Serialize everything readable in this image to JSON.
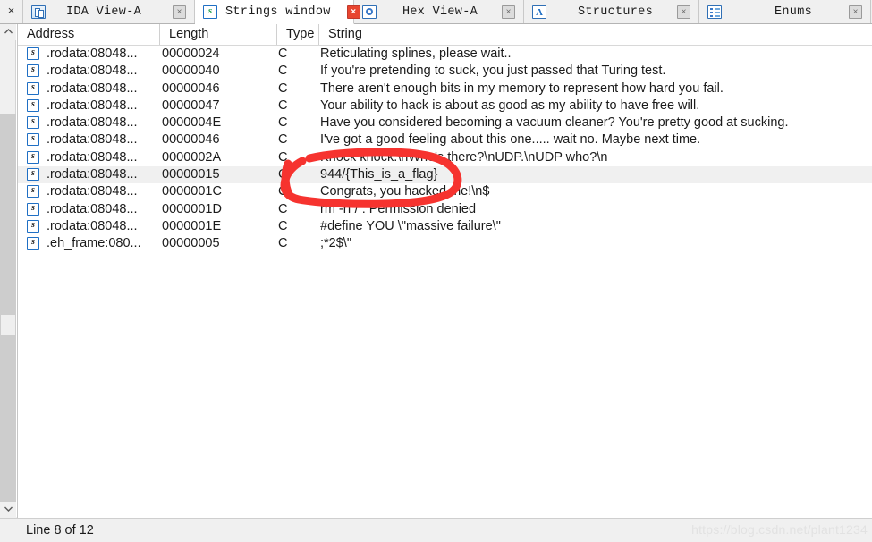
{
  "window": {
    "close_all_glyph": "×"
  },
  "tabs": [
    {
      "label": "IDA View-A",
      "icon": "document-icon",
      "active": false,
      "close_glyph": "×"
    },
    {
      "label": "Strings window",
      "icon": "strings-icon",
      "active": true,
      "close_glyph": "×"
    },
    {
      "label": "Hex View-A",
      "icon": "hex-view-icon",
      "active": false,
      "close_glyph": "×"
    },
    {
      "label": "Structures",
      "icon": "structures-icon",
      "active": false,
      "close_glyph": "×"
    },
    {
      "label": "Enums",
      "icon": "enums-icon",
      "active": false,
      "close_glyph": "×"
    }
  ],
  "table": {
    "columns": [
      "Address",
      "Length",
      "Type",
      "String"
    ],
    "rows": [
      {
        "address": ".rodata:08048...",
        "length": "00000024",
        "type": "C",
        "string": "Reticulating splines, please wait..",
        "selected": false
      },
      {
        "address": ".rodata:08048...",
        "length": "00000040",
        "type": "C",
        "string": "If you're pretending to suck, you just passed that Turing test.",
        "selected": false
      },
      {
        "address": ".rodata:08048...",
        "length": "00000046",
        "type": "C",
        "string": "There aren't enough bits in my memory to represent how hard you fail.",
        "selected": false
      },
      {
        "address": ".rodata:08048...",
        "length": "00000047",
        "type": "C",
        "string": "Your ability to hack is about as good as my ability to have free will.",
        "selected": false
      },
      {
        "address": ".rodata:08048...",
        "length": "0000004E",
        "type": "C",
        "string": "Have you considered becoming a vacuum cleaner? You're pretty good at sucking.",
        "selected": false
      },
      {
        "address": ".rodata:08048...",
        "length": "00000046",
        "type": "C",
        "string": "I've got a good feeling about this one..... wait no. Maybe next time.",
        "selected": false
      },
      {
        "address": ".rodata:08048...",
        "length": "0000002A",
        "type": "C",
        "string": "Knock knock.\\nWho's there?\\nUDP.\\nUDP who?\\n",
        "selected": false
      },
      {
        "address": ".rodata:08048...",
        "length": "00000015",
        "type": "C",
        "string": "944/{This_is_a_flag}",
        "selected": true
      },
      {
        "address": ".rodata:08048...",
        "length": "0000001C",
        "type": "C",
        "string": "Congrats, you hacked me!\\n$",
        "selected": false
      },
      {
        "address": ".rodata:08048...",
        "length": "0000001D",
        "type": "C",
        "string": "rm -rf / : Permission denied",
        "selected": false
      },
      {
        "address": ".rodata:08048...",
        "length": "0000001E",
        "type": "C",
        "string": "#define YOU \\\"massive failure\\\"",
        "selected": false
      },
      {
        "address": ".eh_frame:080...",
        "length": "00000005",
        "type": "C",
        "string": ";*2$\\\"",
        "selected": false
      }
    ]
  },
  "annotation": {
    "kind": "hand-drawn-red-ellipse",
    "color": "#f6332f",
    "targets_row_index": 7
  },
  "statusbar": {
    "line_status": "Line 8 of 12",
    "watermark": "https://blog.csdn.net/plant1234"
  },
  "colors": {
    "selection": "#f0f0f0",
    "annotation_red": "#f6332f",
    "active_close": "#e8452f",
    "chrome": "#f0f0f0"
  }
}
